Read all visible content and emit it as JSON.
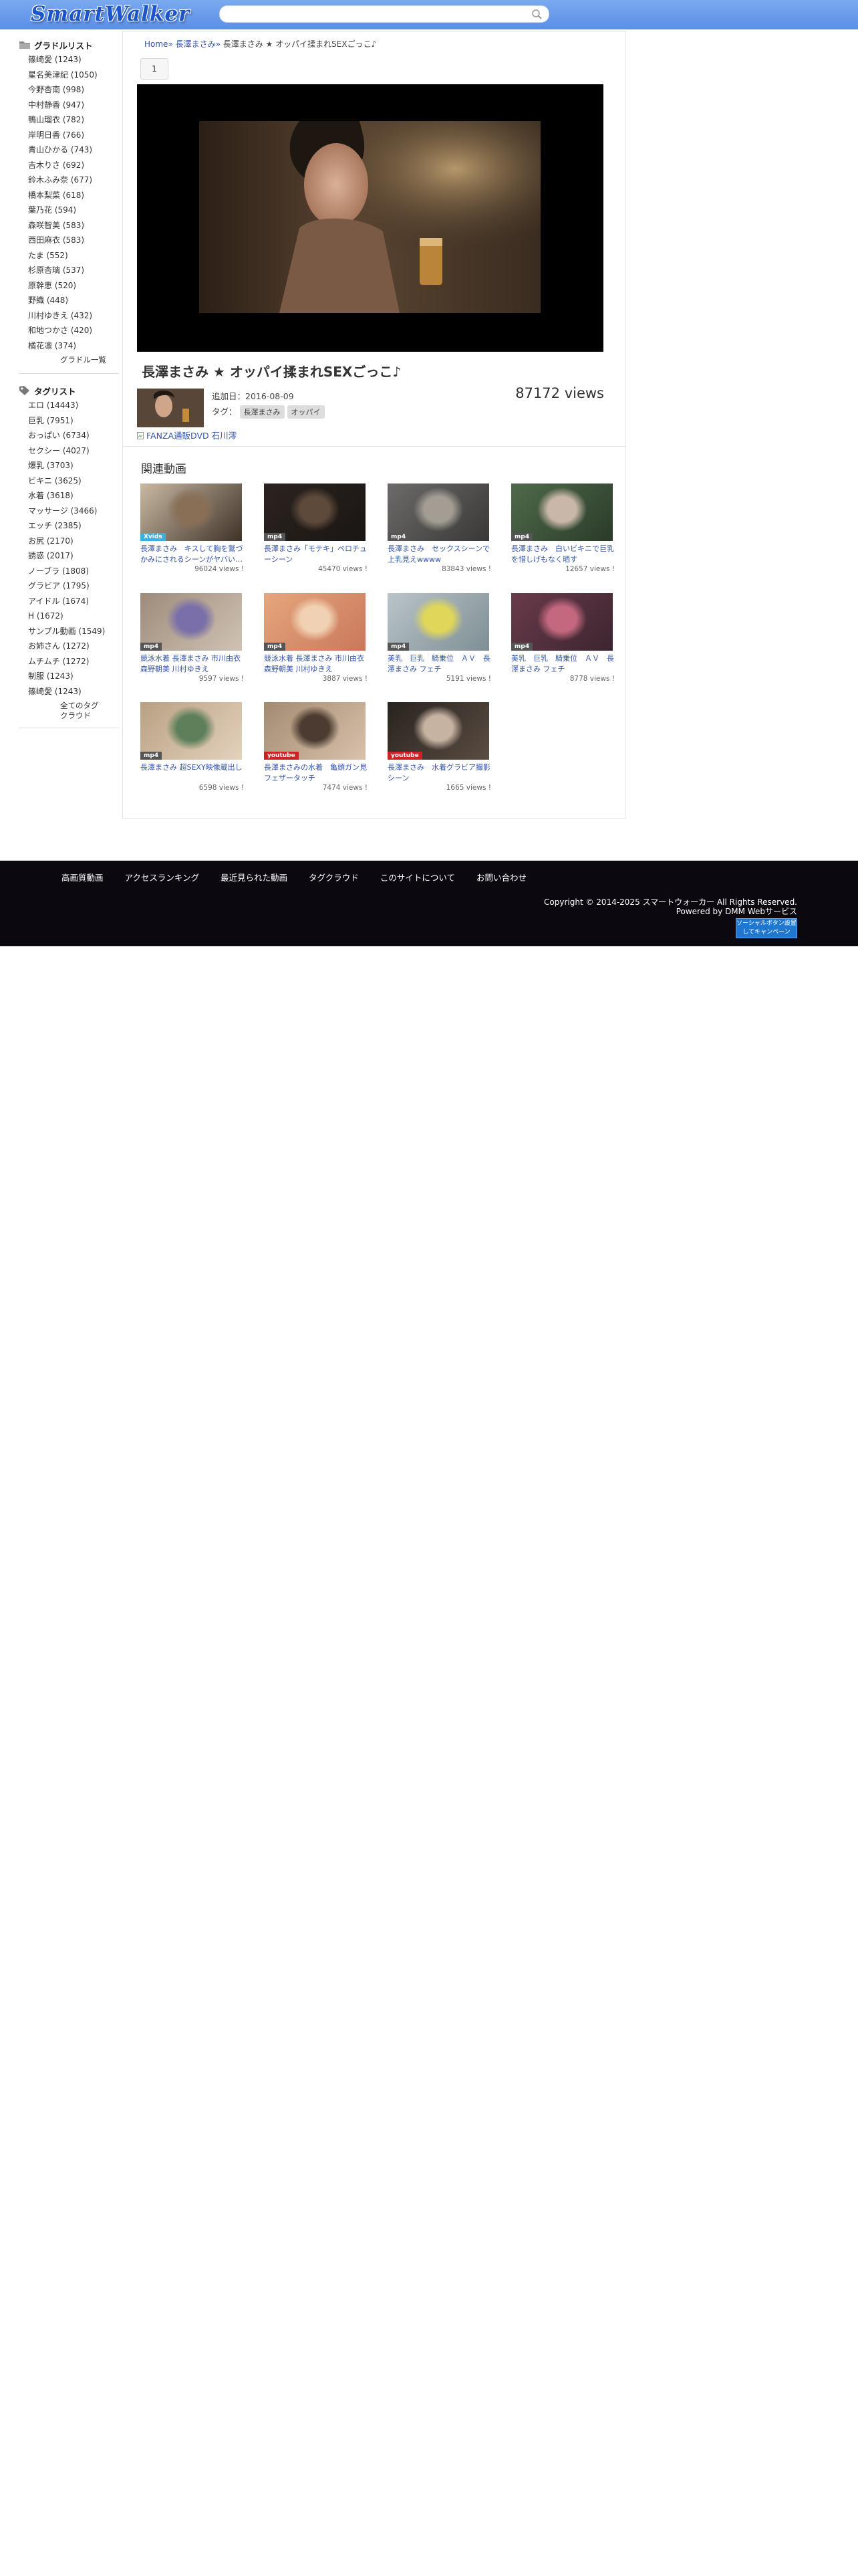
{
  "header": {
    "logo": "SmartWalker",
    "search_placeholder": ""
  },
  "sidebar": {
    "gravure_title": "グラドルリスト",
    "gravure": [
      "篠崎愛 (1243)",
      "星名美津紀 (1050)",
      "今野杏南 (998)",
      "中村静香 (947)",
      "鴨山瑠衣 (782)",
      "岸明日香 (766)",
      "青山ひかる (743)",
      "吉木りさ (692)",
      "鈴木ふみ奈 (677)",
      "橋本梨菜 (618)",
      "葉乃花 (594)",
      "森咲智美 (583)",
      "西田麻衣 (583)",
      "たま (552)",
      "杉原杏璃 (537)",
      "原幹恵 (520)",
      "野織 (448)",
      "川村ゆきえ (432)",
      "和地つかさ (420)",
      "橘花凛 (374)"
    ],
    "gravure_more": "グラドル一覧",
    "tag_title": "タグリスト",
    "tags": [
      "エロ (14443)",
      "巨乳 (7951)",
      "おっぱい (6734)",
      "セクシー (4027)",
      "爆乳 (3703)",
      "ビキニ (3625)",
      "水着 (3618)",
      "マッサージ (3466)",
      "エッチ (2385)",
      "お尻 (2170)",
      "誘惑 (2017)",
      "ノーブラ (1808)",
      "グラビア (1795)",
      "アイドル (1674)",
      "H (1672)",
      "サンプル動画 (1549)",
      "お姉さん (1272)",
      "ムチムチ (1272)",
      "制服 (1243)",
      "篠崎愛 (1243)"
    ],
    "tag_more": "全てのタグクラウド"
  },
  "main": {
    "breadcrumb": {
      "home": "Home»",
      "actress": "長澤まさみ»",
      "current": "長澤まさみ ★ オッパイ揉まれSEXごっこ♪"
    },
    "page": "1",
    "title": "長澤まさみ ★ オッパイ揉まれSEXごっこ♪",
    "added": "追加日：2016-08-09",
    "tag_label": "タグ：",
    "tags": [
      "長澤まさみ",
      "オッパイ"
    ],
    "views": "87172 views",
    "ad_text": "FANZA通販DVD 石川澪",
    "related_title": "関連動画",
    "related": [
      {
        "caption": "長澤まさみ　キスして胸を鷲づかみにされるシーンがヤバい…",
        "views": "96024 views !",
        "badge": "Xvids",
        "badge_color": "#3ab0e2",
        "palette": [
          "#c9b9a3",
          "#8a6f57",
          "#3f3228"
        ]
      },
      {
        "caption": "長澤まさみ「モテキ」ベロチューシーン",
        "views": "45470 views !",
        "badge": "mp4",
        "badge_color": "#555555",
        "palette": [
          "#2b231f",
          "#5e4a3b",
          "#1a1614"
        ]
      },
      {
        "caption": "長澤まさみ　セックスシーンで上乳見えwwww",
        "views": "83843 views !",
        "badge": "mp4",
        "badge_color": "#555555",
        "palette": [
          "#6d6b6a",
          "#a39d94",
          "#3a3836"
        ]
      },
      {
        "caption": "長澤まさみ　白いビキニで巨乳を惜しげもなく晒す",
        "views": "12657 views !",
        "badge": "mp4",
        "badge_color": "#555555",
        "palette": [
          "#4f6a4a",
          "#c9b8a9",
          "#2a3b29"
        ]
      },
      {
        "caption": "競泳水着 長澤まさみ 市川由衣 森野朝美 川村ゆきえ",
        "views": "9597 views !",
        "badge": "mp4",
        "badge_color": "#555555",
        "palette": [
          "#9d8b7a",
          "#7a6fa8",
          "#d0c3b4"
        ]
      },
      {
        "caption": "競泳水着 長澤まさみ 市川由衣 森野朝美 川村ゆきえ",
        "views": "3887 views !",
        "badge": "mp4",
        "badge_color": "#555555",
        "palette": [
          "#e6a67d",
          "#f1d1b3",
          "#c9785a"
        ]
      },
      {
        "caption": "美乳　巨乳　騎乗位　ＡＶ　長澤まさみ フェチ",
        "views": "5191 views !",
        "badge": "mp4",
        "badge_color": "#555555",
        "palette": [
          "#b9c4c8",
          "#e0d75a",
          "#7f8f95"
        ]
      },
      {
        "caption": "美乳　巨乳　騎乗位　ＡＶ　長澤まさみ フェチ",
        "views": "8778 views !",
        "badge": "mp4",
        "badge_color": "#555555",
        "palette": [
          "#6a3a4a",
          "#c4687f",
          "#3b2530"
        ]
      },
      {
        "caption": "長澤まさみ 超SEXY映像蔵出し",
        "views": "6598 views !",
        "badge": "mp4",
        "badge_color": "#555555",
        "palette": [
          "#b9a083",
          "#5d7f5a",
          "#e4d2bd"
        ]
      },
      {
        "caption": "長澤まさみの水着　亀頭ガン見フェザータッチ",
        "views": "7474 views !",
        "badge": "youtube",
        "badge_color": "#cc2222",
        "palette": [
          "#a48a72",
          "#4b3b30",
          "#d8c2ab"
        ]
      },
      {
        "caption": "長澤まさみ　水着グラビア撮影シーン",
        "views": "1665 views !",
        "badge": "youtube",
        "badge_color": "#cc2222",
        "palette": [
          "#28231f",
          "#c7b3a2",
          "#5a4c42"
        ]
      }
    ]
  },
  "footer": {
    "nav": [
      "高画質動画",
      "アクセスランキング",
      "最近見られた動画",
      "タグクラウド",
      "このサイトについて",
      "お問い合わせ"
    ],
    "copyright": "Copyright © 2014-2025 スマートウォーカー All Rights Reserved.",
    "powered": "Powered by DMM Webサービス",
    "badge_line1": "ソーシャルボタン設置",
    "badge_line2": "してキャンペーン"
  },
  "colors": {
    "header_blue": "#5b8fe6",
    "link_blue": "#3355aa",
    "footer_bg": "#0b0810"
  }
}
